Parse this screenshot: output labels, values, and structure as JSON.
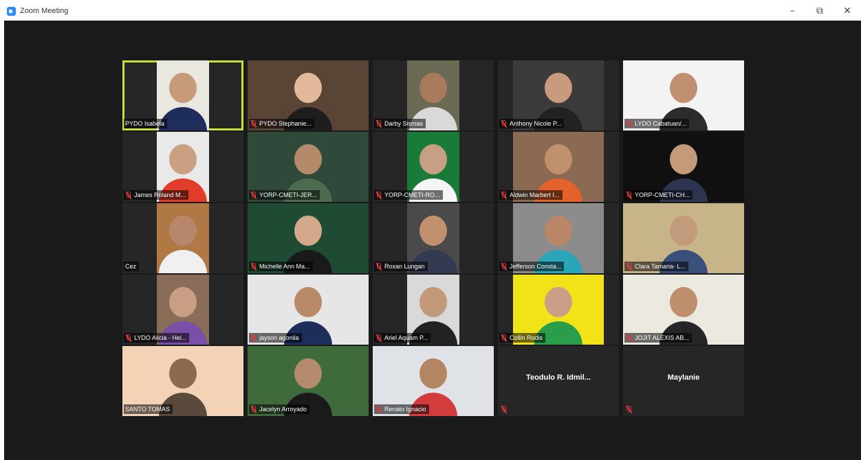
{
  "window": {
    "title": "Zoom Meeting",
    "icon": "zoom-logo-icon",
    "controls": {
      "minimize": "–",
      "restore": "⧉",
      "close": "✕"
    }
  },
  "participants": [
    {
      "name": "PYDO Isabela",
      "muted": false,
      "active": true,
      "video": true,
      "bg": "#e8e8e0",
      "skin": "#c79a7a",
      "shirt": "#1f2d5a"
    },
    {
      "name": "PYDO Stephanie...",
      "muted": true,
      "video": true,
      "bg": "#5a4436",
      "skin": "#e2b99b",
      "shirt": "#1d1d1d"
    },
    {
      "name": "Darby Sismas",
      "muted": true,
      "video": true,
      "bg": "#6b6a55",
      "skin": "#a77b5c",
      "shirt": "#d9d9d9"
    },
    {
      "name": "Anthony Nicole P...",
      "muted": true,
      "video": true,
      "bg": "#3b3b3b",
      "skin": "#c89a7e",
      "shirt": "#222222"
    },
    {
      "name": "LYDO Cabatuan/...",
      "muted": true,
      "video": true,
      "bg": "#f3f3f3",
      "skin": "#c09070",
      "shirt": "#2c2c2c"
    },
    {
      "name": "James Roland M...",
      "muted": true,
      "video": true,
      "bg": "#e9e9e9",
      "skin": "#caa083",
      "shirt": "#e23c2c"
    },
    {
      "name": "YORP-CMETI-JER...",
      "muted": true,
      "video": true,
      "bg": "#2f4a3a",
      "skin": "#b48a6a",
      "shirt": "#4c6b4f"
    },
    {
      "name": "YORP-CMETI-RO...",
      "muted": true,
      "video": true,
      "bg": "#1a7a3a",
      "skin": "#c79f84",
      "shirt": "#f5f5f5"
    },
    {
      "name": "Aldwin Marbert I...",
      "muted": true,
      "video": true,
      "bg": "#8a6a52",
      "skin": "#c1906c",
      "shirt": "#e2622a"
    },
    {
      "name": "YORP-CMETI-CH...",
      "muted": true,
      "video": true,
      "bg": "#101010",
      "skin": "#c39b7b",
      "shirt": "#2d3550"
    },
    {
      "name": "Cez",
      "muted": false,
      "video": true,
      "bg": "#b07845",
      "skin": "#b8866a",
      "shirt": "#f0f0f0"
    },
    {
      "name": "Michelle Ann Ma...",
      "muted": true,
      "video": true,
      "bg": "#1f4a34",
      "skin": "#d4a98b",
      "shirt": "#1a1a1a"
    },
    {
      "name": "Roxan Lungan",
      "muted": true,
      "video": true,
      "bg": "#4a4a4a",
      "skin": "#c1906f",
      "shirt": "#333b52"
    },
    {
      "name": "Jefferson Consta...",
      "muted": true,
      "video": true,
      "bg": "#8c8c8c",
      "skin": "#b98767",
      "shirt": "#2aa6b8"
    },
    {
      "name": "Clara Tamaria- L...",
      "muted": true,
      "video": true,
      "bg": "#c7b589",
      "skin": "#c29a7c",
      "shirt": "#3a4f7a"
    },
    {
      "name": "LYDO Alicia - Hei...",
      "muted": true,
      "video": true,
      "bg": "#8a6d58",
      "skin": "#c89e84",
      "shirt": "#7a4fa8"
    },
    {
      "name": "jayson agonila",
      "muted": true,
      "video": true,
      "bg": "#e6e6e6",
      "skin": "#b98a6a",
      "shirt": "#1d2e5a"
    },
    {
      "name": "Ariel Aquam P...",
      "muted": true,
      "video": true,
      "bg": "#d9d9d9",
      "skin": "#c29979",
      "shirt": "#222222"
    },
    {
      "name": "Collin Rodis",
      "muted": true,
      "video": true,
      "bg": "#f1e317",
      "skin": "#c9a087",
      "shirt": "#2a9d4b"
    },
    {
      "name": "JOJIT ALEXIS AB...",
      "muted": true,
      "video": true,
      "bg": "#ece9e0",
      "skin": "#bf8e6d",
      "shirt": "#262626"
    },
    {
      "name": "SANTO TOMAS",
      "muted": false,
      "video": true,
      "bg": "#f2d3b6",
      "skin": "#8a6a50",
      "shirt": "#5a4a3c"
    },
    {
      "name": "Jacelyn Arroyado",
      "muted": true,
      "video": true,
      "bg": "#3f6a3c",
      "skin": "#b48b6c",
      "shirt": "#1a1a1a"
    },
    {
      "name": "Renato Ignacio",
      "muted": true,
      "video": true,
      "bg": "#dfe3e8",
      "skin": "#b38562",
      "shirt": "#d23c3c"
    },
    {
      "name": "Teodulo R. Idmil...",
      "muted": true,
      "video": false
    },
    {
      "name": "Maylanie",
      "muted": true,
      "video": false
    }
  ]
}
